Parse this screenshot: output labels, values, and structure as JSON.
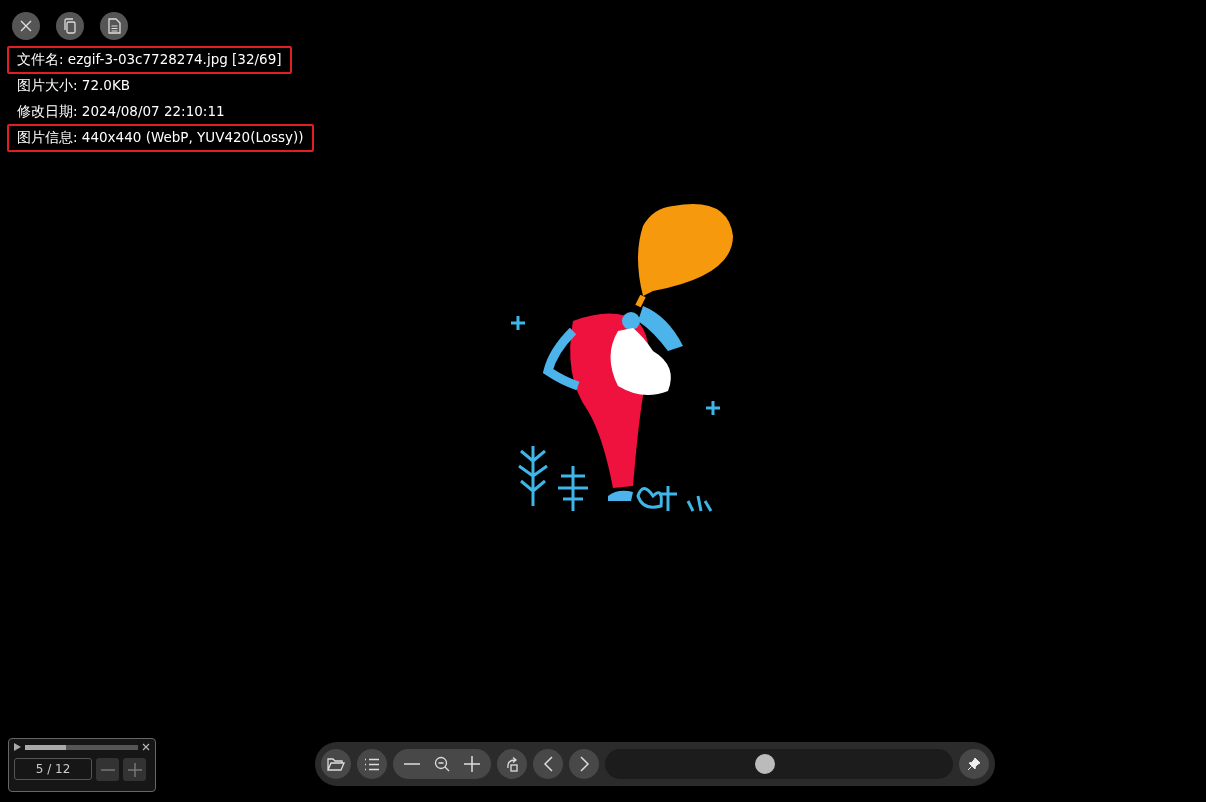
{
  "top_buttons": [
    {
      "kind": "close"
    },
    {
      "kind": "copy"
    },
    {
      "kind": "document"
    }
  ],
  "info_lines": [
    {
      "text": "文件名: ezgif-3-03c7728274.jpg [32/69]",
      "highlighted": true
    },
    {
      "text": "图片大小: 72.0KB",
      "highlighted": false
    },
    {
      "text": "修改日期: 2024/08/07 22:10:11",
      "highlighted": false
    },
    {
      "text": "图片信息: 440x440 (WebP, YUV420(Lossy))",
      "highlighted": true
    }
  ],
  "player": {
    "level": 0.36,
    "frame": "5 / 12"
  },
  "toolbar": {
    "zoom_slider": {
      "level": 0.46
    }
  }
}
